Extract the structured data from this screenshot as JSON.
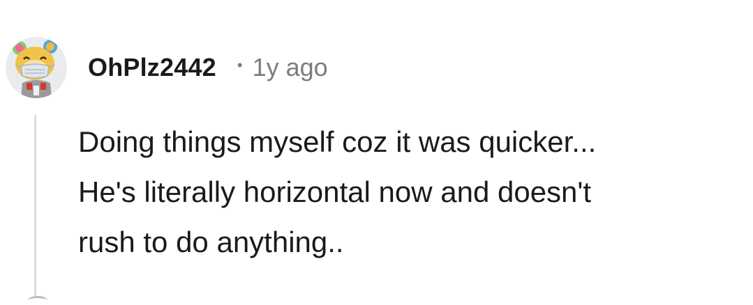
{
  "comment": {
    "username": "OhPlz2442",
    "separator": "•",
    "time": "1y ago",
    "body_lines": [
      "Doing things myself coz it was quicker...",
      "He's literally horizontal now and doesn't",
      "rush to do anything.."
    ]
  },
  "icons": {
    "avatar": "snoo-avatar-masked-bear-icon"
  },
  "colors": {
    "username": "#1a1a1b",
    "meta": "#7c7c7c",
    "body": "#1a1a1b",
    "thread_line": "#dcdcdc",
    "avatar_bg": "#e9ebee"
  }
}
